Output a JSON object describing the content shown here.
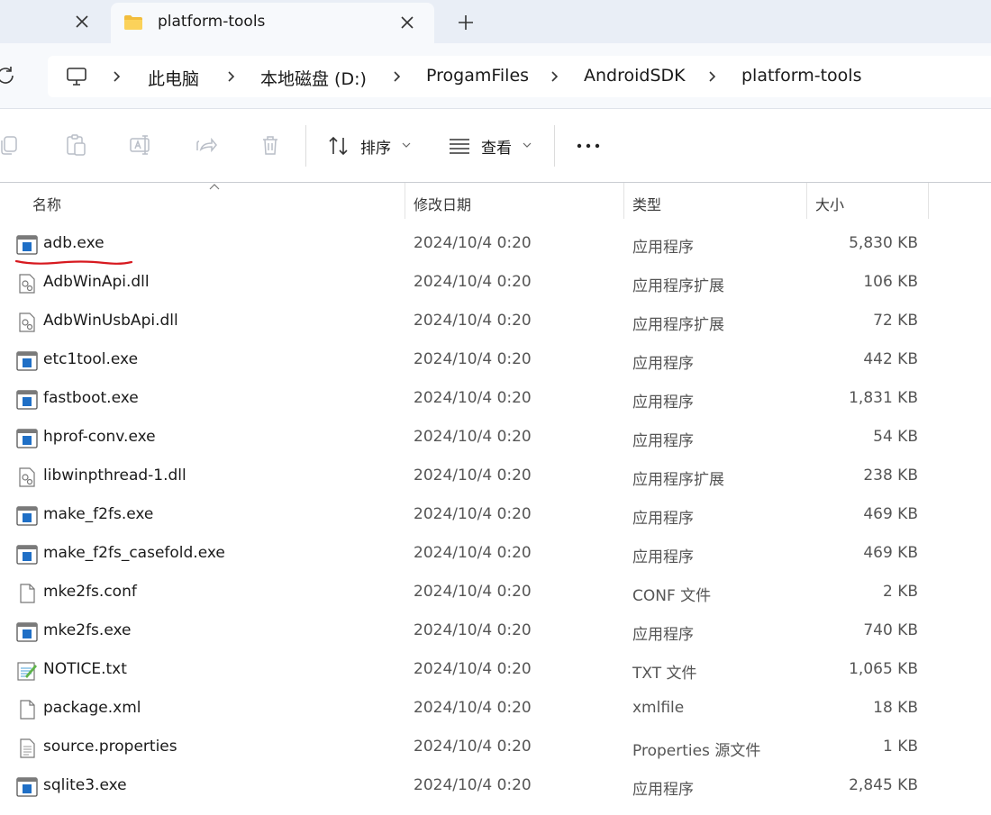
{
  "tabs": {
    "active_title": "platform-tools"
  },
  "breadcrumb": [
    {
      "label": "此电脑"
    },
    {
      "label": "本地磁盘 (D:)"
    },
    {
      "label": "ProgamFiles"
    },
    {
      "label": "AndroidSDK"
    },
    {
      "label": "platform-tools"
    }
  ],
  "toolbar": {
    "sort_label": "排序",
    "view_label": "查看"
  },
  "columns": {
    "name": "名称",
    "date": "修改日期",
    "type": "类型",
    "size": "大小"
  },
  "files": [
    {
      "name": "adb.exe",
      "date": "2024/10/4 0:20",
      "type": "应用程序",
      "size": "5,830 KB",
      "icon": "exe-icon"
    },
    {
      "name": "AdbWinApi.dll",
      "date": "2024/10/4 0:20",
      "type": "应用程序扩展",
      "size": "106 KB",
      "icon": "dll-icon"
    },
    {
      "name": "AdbWinUsbApi.dll",
      "date": "2024/10/4 0:20",
      "type": "应用程序扩展",
      "size": "72 KB",
      "icon": "dll-icon"
    },
    {
      "name": "etc1tool.exe",
      "date": "2024/10/4 0:20",
      "type": "应用程序",
      "size": "442 KB",
      "icon": "exe-icon"
    },
    {
      "name": "fastboot.exe",
      "date": "2024/10/4 0:20",
      "type": "应用程序",
      "size": "1,831 KB",
      "icon": "exe-icon"
    },
    {
      "name": "hprof-conv.exe",
      "date": "2024/10/4 0:20",
      "type": "应用程序",
      "size": "54 KB",
      "icon": "exe-icon"
    },
    {
      "name": "libwinpthread-1.dll",
      "date": "2024/10/4 0:20",
      "type": "应用程序扩展",
      "size": "238 KB",
      "icon": "dll-icon"
    },
    {
      "name": "make_f2fs.exe",
      "date": "2024/10/4 0:20",
      "type": "应用程序",
      "size": "469 KB",
      "icon": "exe-icon"
    },
    {
      "name": "make_f2fs_casefold.exe",
      "date": "2024/10/4 0:20",
      "type": "应用程序",
      "size": "469 KB",
      "icon": "exe-icon"
    },
    {
      "name": "mke2fs.conf",
      "date": "2024/10/4 0:20",
      "type": "CONF 文件",
      "size": "2 KB",
      "icon": "file-icon"
    },
    {
      "name": "mke2fs.exe",
      "date": "2024/10/4 0:20",
      "type": "应用程序",
      "size": "740 KB",
      "icon": "exe-icon"
    },
    {
      "name": "NOTICE.txt",
      "date": "2024/10/4 0:20",
      "type": "TXT 文件",
      "size": "1,065 KB",
      "icon": "notepad-icon"
    },
    {
      "name": "package.xml",
      "date": "2024/10/4 0:20",
      "type": "xmlfile",
      "size": "18 KB",
      "icon": "file-icon"
    },
    {
      "name": "source.properties",
      "date": "2024/10/4 0:20",
      "type": "Properties 源文件",
      "size": "1 KB",
      "icon": "text-file-icon"
    },
    {
      "name": "sqlite3.exe",
      "date": "2024/10/4 0:20",
      "type": "应用程序",
      "size": "2,845 KB",
      "icon": "exe-icon"
    }
  ],
  "colors": {
    "tab_strip": "#e9eef6",
    "exe_blue": "#1f6fc6",
    "annotation_red": "#d7191f"
  }
}
